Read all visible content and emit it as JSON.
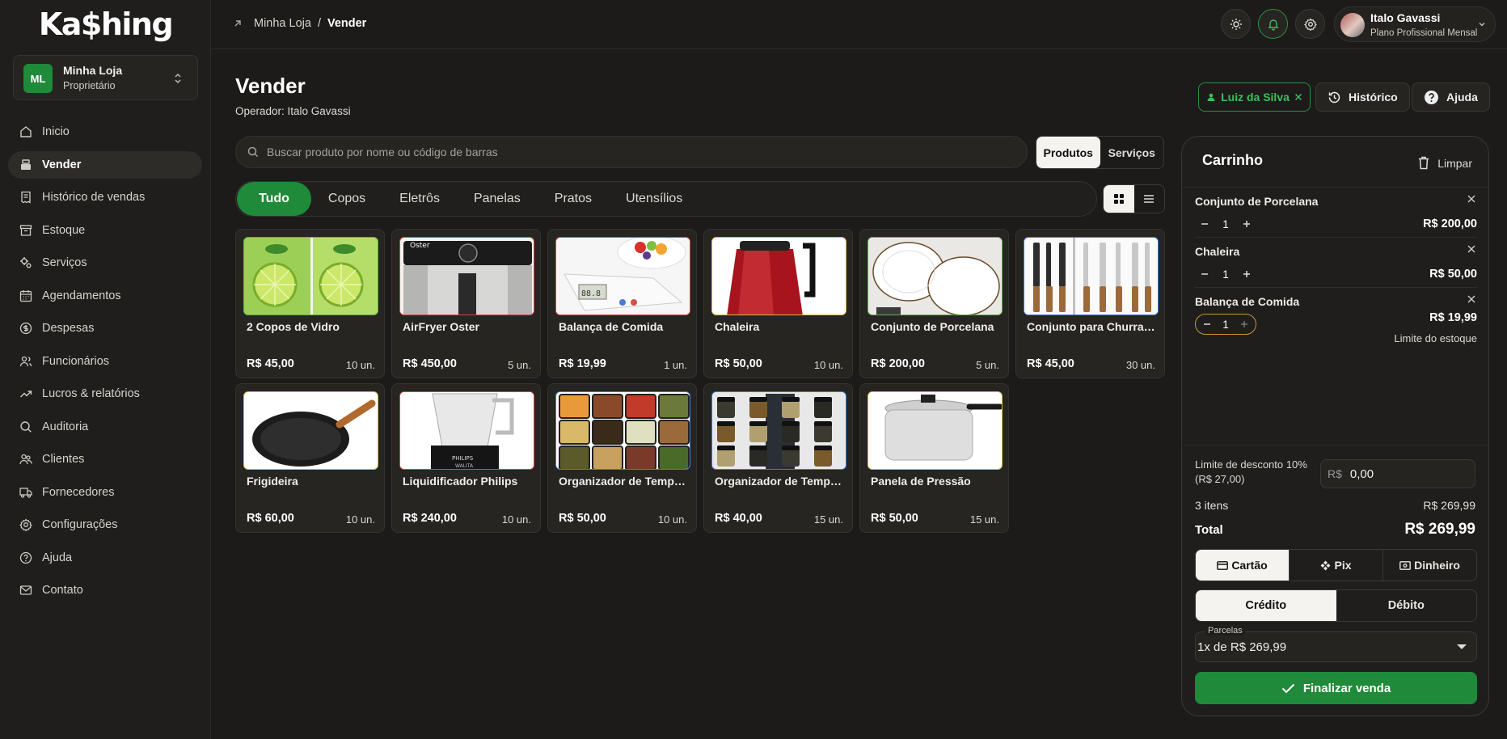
{
  "brand": {
    "logo": "Ka$hing"
  },
  "store": {
    "initials": "ML",
    "name": "Minha Loja",
    "role": "Proprietário"
  },
  "nav": [
    {
      "label": "Inicio",
      "icon": "home-icon"
    },
    {
      "label": "Vender",
      "icon": "register-icon",
      "active": true
    },
    {
      "label": "Histórico de vendas",
      "icon": "receipt-icon"
    },
    {
      "label": "Estoque",
      "icon": "archive-icon"
    },
    {
      "label": "Serviços",
      "icon": "gears-icon"
    },
    {
      "label": "Agendamentos",
      "icon": "calendar-icon"
    },
    {
      "label": "Despesas",
      "icon": "dollar-circle-icon"
    },
    {
      "label": "Funcionários",
      "icon": "users-icon"
    },
    {
      "label": "Lucros & relatórios",
      "icon": "trending-up-icon"
    },
    {
      "label": "Auditoria",
      "icon": "search-icon"
    },
    {
      "label": "Clientes",
      "icon": "user-group-icon"
    },
    {
      "label": "Fornecedores",
      "icon": "truck-icon"
    },
    {
      "label": "Configurações",
      "icon": "gear-icon"
    },
    {
      "label": "Ajuda",
      "icon": "help-circle-icon"
    },
    {
      "label": "Contato",
      "icon": "mail-icon"
    }
  ],
  "breadcrumb": {
    "parent": "Minha Loja",
    "separator": "/",
    "current": "Vender"
  },
  "user": {
    "name": "Italo Gavassi",
    "plan": "Plano Profissional Mensal"
  },
  "page": {
    "title": "Vender",
    "operator": "Operador: Italo Gavassi"
  },
  "actions": {
    "client": "Luiz da Silva",
    "history": "Histórico",
    "help": "Ajuda"
  },
  "search": {
    "placeholder": "Buscar produto por nome ou código de barras"
  },
  "mode": {
    "products": "Produtos",
    "services": "Serviços",
    "selected": "Produtos"
  },
  "categories": [
    "Tudo",
    "Copos",
    "Eletrôs",
    "Panelas",
    "Pratos",
    "Utensílios"
  ],
  "active_category": "Tudo",
  "products": [
    {
      "name": "2 Copos de Vidro",
      "price": "R$ 45,00",
      "stock": "10 un.",
      "border": "#5fb24a",
      "art": "lime"
    },
    {
      "name": "AirFryer Oster",
      "price": "R$ 450,00",
      "stock": "5 un.",
      "border": "#d9473d",
      "art": "airfryer"
    },
    {
      "name": "Balança de Comida",
      "price": "R$ 19,99",
      "stock": "1 un.",
      "border": "#d9473d",
      "art": "scale"
    },
    {
      "name": "Chaleira",
      "price": "R$ 50,00",
      "stock": "10 un.",
      "border": "#d9b63d",
      "art": "kettle"
    },
    {
      "name": "Conjunto de Porcelana",
      "price": "R$ 200,00",
      "stock": "5 un.",
      "border": "#5fb24a",
      "art": "plates"
    },
    {
      "name": "Conjunto para Churrasco",
      "price": "R$ 45,00",
      "stock": "30 un.",
      "border": "#3d7bd9",
      "art": "knives"
    },
    {
      "name": "Frigideira",
      "price": "R$ 60,00",
      "stock": "10 un.",
      "border": "#d9b63d",
      "art": "pan"
    },
    {
      "name": "Liquidificador Philips",
      "price": "R$ 240,00",
      "stock": "10 un.",
      "border": "#d9473d",
      "art": "blender"
    },
    {
      "name": "Organizador de Temperos",
      "price": "R$ 50,00",
      "stock": "10 un.",
      "border": "#3d7bd9",
      "art": "jars"
    },
    {
      "name": "Organizador de Temperos",
      "price": "R$ 40,00",
      "stock": "15 un.",
      "border": "#3d7bd9",
      "art": "rack"
    },
    {
      "name": "Panela de Pressão",
      "price": "R$ 50,00",
      "stock": "15 un.",
      "border": "#d9b63d",
      "art": "pressure"
    }
  ],
  "cart": {
    "title": "Carrinho",
    "clear": "Limpar",
    "items": [
      {
        "name": "Conjunto de Porcelana",
        "qty": "1",
        "price": "R$ 200,00"
      },
      {
        "name": "Chaleira",
        "qty": "1",
        "price": "R$ 50,00"
      },
      {
        "name": "Balança de Comida",
        "qty": "1",
        "price": "R$ 19,99",
        "warning": "Limite do estoque"
      }
    ],
    "discount_label": "Limite de desconto 10% (R$ 27,00)",
    "discount_currency": "R$",
    "discount_value": "0,00",
    "items_count": "3 itens",
    "subtotal": "R$ 269,99",
    "total_label": "Total",
    "total": "R$ 269,99",
    "payment_methods": [
      "Cartão",
      "Pix",
      "Dinheiro"
    ],
    "payment_selected": "Cartão",
    "card_types": [
      "Crédito",
      "Débito"
    ],
    "card_selected": "Crédito",
    "installments_label": "Parcelas",
    "installments_value": "1x de R$ 269,99",
    "finish": "Finalizar venda"
  },
  "colors": {
    "accent_green": "#1f8a3a",
    "bg": "#1c1b19",
    "warning": "#c8962f"
  }
}
